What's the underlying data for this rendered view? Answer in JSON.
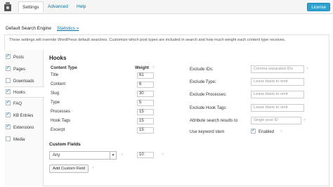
{
  "nav": {
    "tabs": [
      "Settings",
      "Advanced",
      "Help"
    ],
    "active_tab": "Settings",
    "license_label": "License"
  },
  "engine": {
    "title": "Default Search Engine",
    "stats_link": "Statistics »",
    "description": "These settings will override WordPress default searches. Customize which post types are included in search and how much weight each content type receives."
  },
  "post_types": [
    {
      "label": "Posts",
      "checked": true
    },
    {
      "label": "Pages",
      "checked": true
    },
    {
      "label": "Downloads",
      "checked": false
    },
    {
      "label": "Hooks",
      "checked": true
    },
    {
      "label": "FAQ",
      "checked": true
    },
    {
      "label": "KB Entries",
      "checked": true
    },
    {
      "label": "Extensions",
      "checked": true
    },
    {
      "label": "Media",
      "checked": false
    }
  ],
  "panel": {
    "title": "Hooks",
    "content_type_header": "Content Type",
    "weight_header": "Weight",
    "rows": [
      {
        "label": "Title",
        "weight": "61"
      },
      {
        "label": "Content",
        "weight": "6"
      },
      {
        "label": "Slug",
        "weight": "30"
      },
      {
        "label": "Type",
        "weight": "5"
      },
      {
        "label": "Processes",
        "weight": "15"
      },
      {
        "label": "Hook Tags",
        "weight": "15"
      },
      {
        "label": "Excerpt",
        "weight": "15"
      }
    ],
    "options": [
      {
        "label": "Exclude IDs:",
        "placeholder": "Comma separated IDs"
      },
      {
        "label": "Exclude Type:",
        "placeholder": "Leave blank to omit"
      },
      {
        "label": "Exclude Processes:",
        "placeholder": "Leave blank to omit"
      },
      {
        "label": "Exclude Hook Tags:",
        "placeholder": "Leave blank to omit"
      },
      {
        "label": "Attribute search results to",
        "placeholder": "Single post ID"
      }
    ],
    "keyword_stem_label": "Use keyword stem",
    "keyword_stem_value": "Enabled",
    "keyword_stem_checked": true,
    "custom_fields_title": "Custom Fields",
    "custom_field_select": "Any",
    "custom_field_weight": "10",
    "add_custom_field_label": "Add Custom Field",
    "help_glyph": "?"
  },
  "colors": {
    "link": "#0074a2",
    "license_button": "#2ea2cc",
    "checkbox_check": "#1e8cbe"
  }
}
